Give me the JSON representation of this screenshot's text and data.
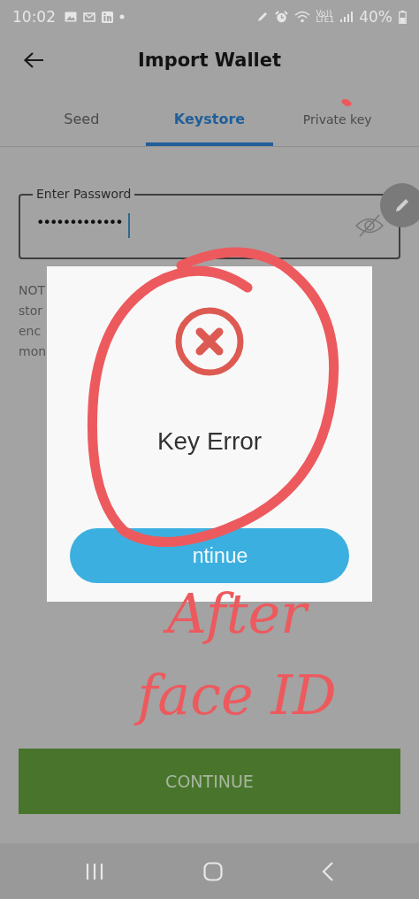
{
  "status_bar": {
    "time": "10:02",
    "volte": "Vo))",
    "network": "LTE1",
    "battery": "40%"
  },
  "header": {
    "title": "Import Wallet"
  },
  "tabs": [
    {
      "label": "Seed",
      "selected": false
    },
    {
      "label": "Keystore",
      "selected": true
    },
    {
      "label": "Private key",
      "selected": false
    }
  ],
  "password_field": {
    "label": "Enter Password",
    "value": "•••••••••••••"
  },
  "note_lines": [
    "NOT",
    "stor",
    "enc",
    "mon"
  ],
  "dialog": {
    "title": "Key Error",
    "button": "ntinue"
  },
  "continue_button": {
    "label": "CONTINUE"
  },
  "annotation": {
    "text": "After face ID"
  }
}
